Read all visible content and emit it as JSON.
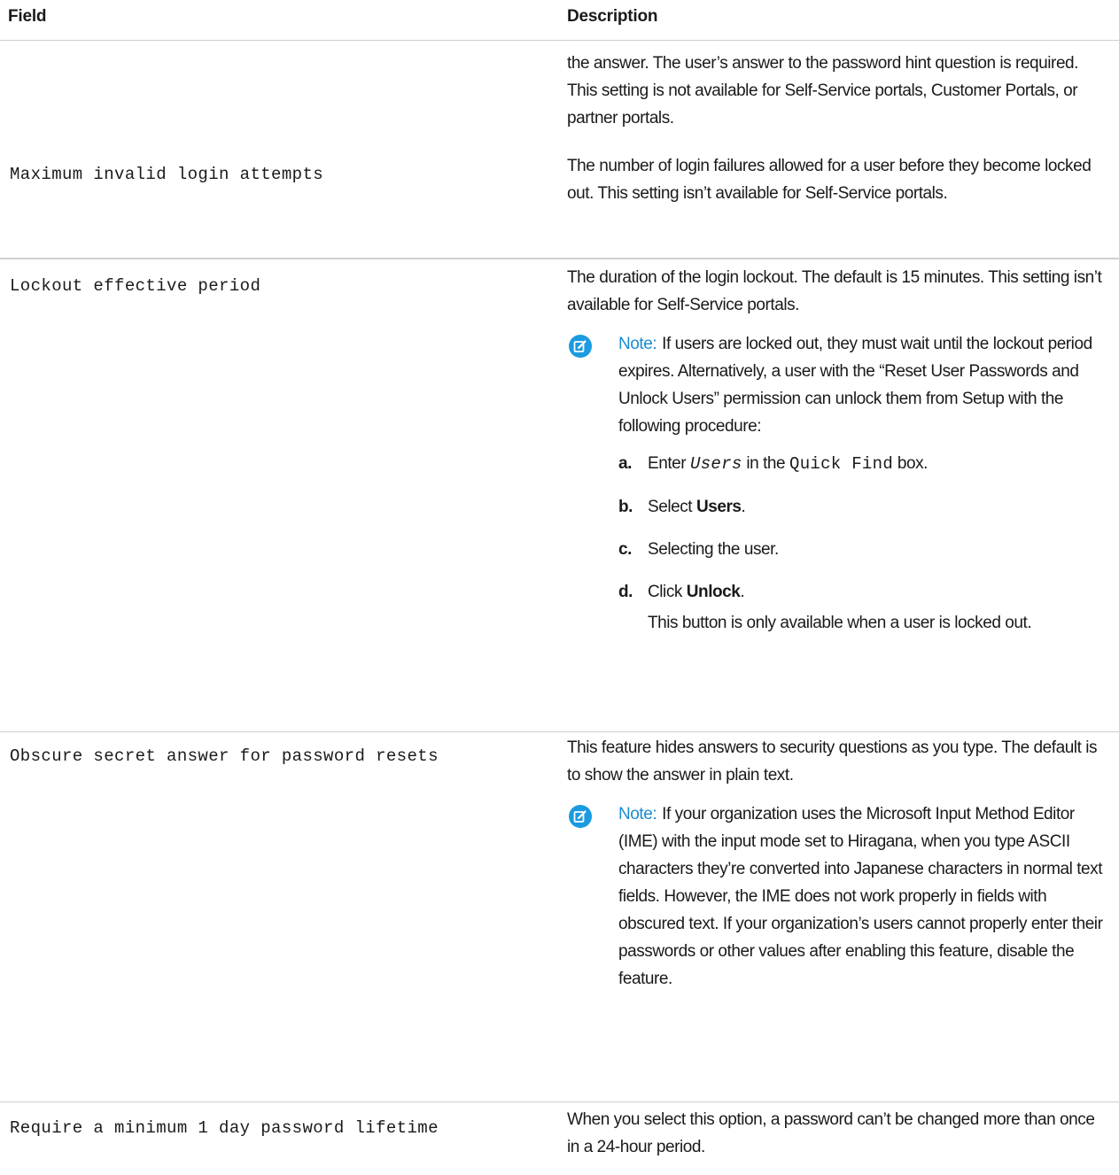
{
  "table": {
    "headers": {
      "field": "Field",
      "description": "Description"
    },
    "row0": {
      "description": "the answer. The user’s answer to the password hint question is required. This setting is not available for Self-Service portals, Customer Portals, or partner portals."
    },
    "row1": {
      "field": "Maximum invalid login attempts",
      "description": "The number of login failures allowed for a user before they become locked out. This setting isn’t available for Self-Service portals."
    },
    "row2": {
      "field": "Lockout effective period",
      "description": "The duration of the login lockout. The default is 15 minutes. This setting isn’t available for Self-Service portals.",
      "note_label": "Note:",
      "note_text": "If users are locked out, they must wait until the lockout period expires. Alternatively, a user with the “Reset User Passwords and Unlock Users” permission can unlock them from Setup with the following procedure:",
      "steps": {
        "a": {
          "letter": "a.",
          "pre": "Enter",
          "code": "Users",
          "mid": "in the",
          "code2": "Quick Find",
          "post": "box."
        },
        "b": {
          "letter": "b.",
          "pre": "Select",
          "bold": "Users",
          "post": "."
        },
        "c": {
          "letter": "c.",
          "text": "Selecting the user."
        },
        "d": {
          "letter": "d.",
          "pre": "Click",
          "bold": "Unlock",
          "post": ".",
          "sub": "This button is only available when a user is locked out."
        }
      }
    },
    "row3": {
      "field": "Obscure secret answer for password resets",
      "description": "This feature hides answers to security questions as you type. The default is to show the answer in plain text.",
      "note_label": "Note:",
      "note_text": "If your organization uses the Microsoft Input Method Editor (IME) with the input mode set to Hiragana, when you type ASCII characters they’re converted into Japanese characters in normal text fields. However, the IME does not work properly in fields with obscured text. If your organization’s users cannot properly enter their passwords or other values after enabling this feature, disable the feature."
    },
    "row4": {
      "field": "Require a minimum 1 day password lifetime",
      "description": "When you select this option, a password can’t be changed more than once in a 24-hour period."
    }
  },
  "colors": {
    "note_accent": "#1b9be0",
    "divider": "#cfcfcf"
  },
  "icons": {
    "note": "edit-note-icon"
  }
}
